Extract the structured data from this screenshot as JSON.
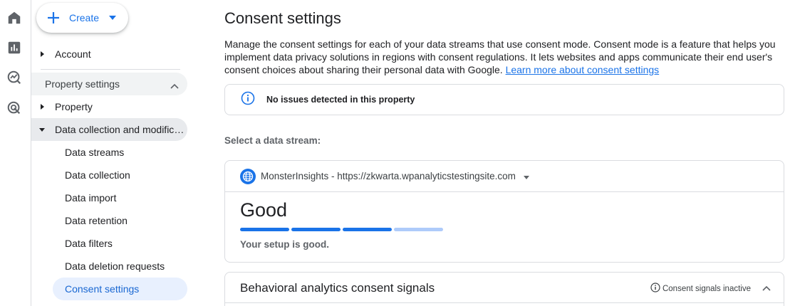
{
  "rail": {
    "icons": [
      "home-icon",
      "reports-icon",
      "explore-icon",
      "advertising-icon"
    ]
  },
  "create": {
    "label": "Create"
  },
  "nav": {
    "account": "Account",
    "group_header": "Property settings",
    "property": "Property",
    "data_collection_group": "Data collection and modifications",
    "sub_items": [
      "Data streams",
      "Data collection",
      "Data import",
      "Data retention",
      "Data filters",
      "Data deletion requests",
      "Consent settings"
    ]
  },
  "main": {
    "title": "Consent settings",
    "description": "Manage the consent settings for each of your data streams that use consent mode. Consent mode is a feature that helps you implement data privacy solutions in regions with consent regulations. It lets websites and apps communicate their end user's consent choices about sharing their personal data with Google.",
    "learn_more": "Learn more about consent settings",
    "info_message": "No issues detected in this property",
    "select_label": "Select a data stream:",
    "stream": {
      "name": "MonsterInsights - https://zkwarta.wpanalyticstestingsite.com",
      "status_title": "Good",
      "status_level": 3,
      "status_max": 4,
      "setup_text": "Your setup is good."
    },
    "behavioral": {
      "title": "Behavioral analytics consent signals",
      "status": "Consent signals inactive"
    }
  },
  "colors": {
    "accent": "#1a73e8",
    "bar_filled": "#1a73e8",
    "bar_empty": "#aecbfa",
    "active_nav_bg": "#e8f0fe",
    "active_nav_text": "#1967d2"
  }
}
